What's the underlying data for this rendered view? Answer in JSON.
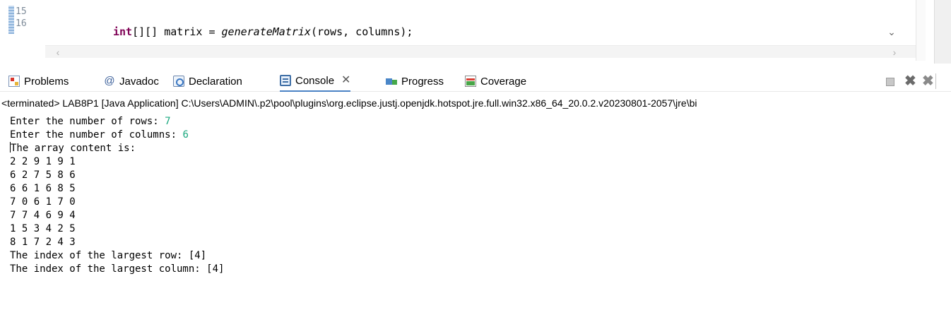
{
  "editor": {
    "line_numbers": [
      "15",
      "16"
    ],
    "code": {
      "keyword": "int",
      "brackets": "[][]",
      "var": " matrix = ",
      "method": "generateMatrix",
      "args": "(rows, columns);"
    }
  },
  "tabs": [
    {
      "label": "Problems",
      "icon": "problems-icon"
    },
    {
      "label": "Javadoc",
      "icon": "javadoc-icon"
    },
    {
      "label": "Declaration",
      "icon": "declaration-icon"
    },
    {
      "label": "Console",
      "icon": "console-icon",
      "active": true
    },
    {
      "label": "Progress",
      "icon": "progress-icon"
    },
    {
      "label": "Coverage",
      "icon": "coverage-icon"
    }
  ],
  "console": {
    "header": "<terminated> LAB8P1 [Java Application] C:\\Users\\ADMIN\\.p2\\pool\\plugins\\org.eclipse.justj.openjdk.hotspot.jre.full.win32.x86_64_20.0.2.v20230801-2057\\jre\\bi",
    "prompt_rows": "Enter the number of rows: ",
    "input_rows": "7",
    "prompt_columns": "Enter the number of columns: ",
    "input_columns": "6",
    "array_heading": "The array content is:",
    "matrix_rows": [
      "2 2 9 1 9 1",
      "6 2 7 5 8 6",
      "6 6 1 6 8 5",
      "7 0 6 1 7 0",
      "7 7 4 6 9 4",
      "1 5 3 4 2 5",
      "8 1 7 2 4 3"
    ],
    "largest_row": "The index of the largest row: [4]",
    "largest_column": "The index of the largest column: [4]"
  },
  "colors": {
    "input_text": "#1aa87f",
    "keyword": "#7f0055",
    "active_tab_underline": "#4b83c5"
  }
}
